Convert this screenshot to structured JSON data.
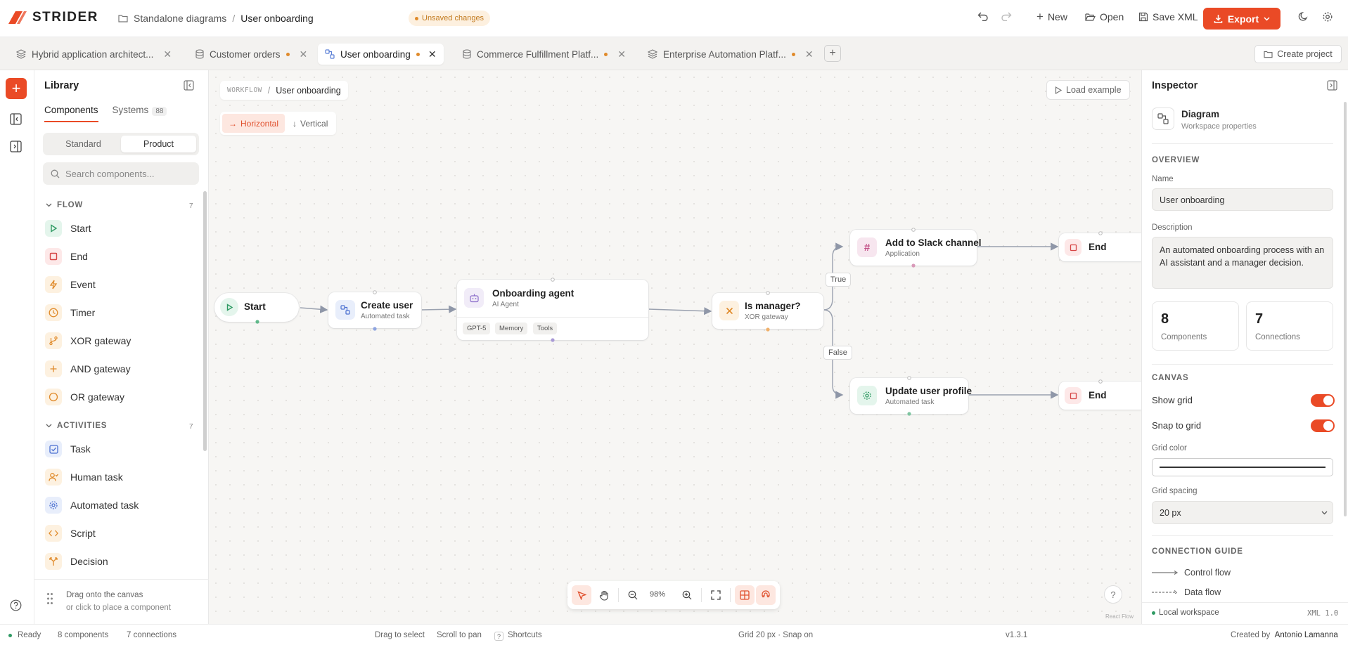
{
  "app": {
    "name": "STRIDER"
  },
  "header": {
    "breadcrumb_root": "Standalone diagrams",
    "breadcrumb_current": "User onboarding",
    "unsaved_label": "Unsaved changes",
    "new_label": "New",
    "open_label": "Open",
    "save_label": "Save XML",
    "export_label": "Export",
    "accent_color": "#ea4a26"
  },
  "tabs": [
    {
      "label": "Hybrid application architect...",
      "icon": "layers-icon",
      "dirty": false,
      "active": false
    },
    {
      "label": "Customer orders",
      "icon": "database-icon",
      "dirty": true,
      "active": false
    },
    {
      "label": "User onboarding",
      "icon": "workflow-icon",
      "dirty": true,
      "active": true
    },
    {
      "label": "Commerce Fulfillment Platf...",
      "icon": "database-icon",
      "dirty": true,
      "active": false
    },
    {
      "label": "Enterprise Automation Platf...",
      "icon": "layers-icon",
      "dirty": true,
      "active": false
    }
  ],
  "create_project_label": "Create project",
  "library": {
    "title": "Library",
    "tab_components": "Components",
    "tab_systems": "Systems",
    "systems_count": "88",
    "seg_standard": "Standard",
    "seg_product": "Product",
    "search_placeholder": "Search components...",
    "sections": [
      {
        "title": "FLOW",
        "count": "7",
        "items": [
          {
            "label": "Start",
            "icon": "play-icon"
          },
          {
            "label": "End",
            "icon": "stop-icon"
          },
          {
            "label": "Event",
            "icon": "bolt-icon"
          },
          {
            "label": "Timer",
            "icon": "clock-icon"
          },
          {
            "label": "XOR gateway",
            "icon": "branch-icon"
          },
          {
            "label": "AND gateway",
            "icon": "plus-icon"
          },
          {
            "label": "OR gateway",
            "icon": "circle-icon"
          }
        ]
      },
      {
        "title": "ACTIVITIES",
        "count": "7",
        "items": [
          {
            "label": "Task",
            "icon": "check-square-icon"
          },
          {
            "label": "Human task",
            "icon": "user-icon"
          },
          {
            "label": "Automated task",
            "icon": "gear-icon"
          },
          {
            "label": "Script",
            "icon": "code-icon"
          },
          {
            "label": "Decision",
            "icon": "split-icon"
          }
        ]
      }
    ],
    "footer_line1": "Drag onto the canvas",
    "footer_line2": "or click to place a component"
  },
  "canvas": {
    "crumb_prefix": "WORKFLOW",
    "crumb_name": "User onboarding",
    "orient_horizontal": "Horizontal",
    "orient_vertical": "Vertical",
    "load_example": "Load example",
    "zoom": "98%",
    "react_flow": "React Flow",
    "nodes": {
      "start": {
        "title": "Start"
      },
      "create_user": {
        "title": "Create user",
        "subtitle": "Automated task"
      },
      "agent": {
        "title": "Onboarding agent",
        "subtitle": "AI Agent",
        "chips": [
          "GPT-5",
          "Memory",
          "Tools"
        ]
      },
      "gateway": {
        "title": "Is manager?",
        "subtitle": "XOR gateway"
      },
      "slack": {
        "title": "Add to Slack channel",
        "subtitle": "Application"
      },
      "update": {
        "title": "Update user profile",
        "subtitle": "Automated task"
      },
      "end1": {
        "title": "End"
      },
      "end2": {
        "title": "End"
      }
    },
    "edge_true": "True",
    "edge_false": "False"
  },
  "inspector": {
    "title": "Inspector",
    "diagram_title": "Diagram",
    "diagram_sub": "Workspace properties",
    "overview": "OVERVIEW",
    "name_label": "Name",
    "name_value": "User onboarding",
    "desc_label": "Description",
    "desc_value": "An automated onboarding process with an AI assistant and a manager decision.",
    "components_count": "8",
    "components_label": "Components",
    "connections_count": "7",
    "connections_label": "Connections",
    "canvas_sec": "CANVAS",
    "show_grid": "Show grid",
    "show_grid_on": true,
    "snap_grid": "Snap to grid",
    "snap_grid_on": true,
    "grid_color_label": "Grid color",
    "grid_spacing_label": "Grid spacing",
    "grid_spacing_value": "20 px",
    "guide_sec": "CONNECTION GUIDE",
    "control_flow": "Control flow",
    "data_flow": "Data flow",
    "workspace": "Local workspace",
    "xml_version": "XML 1.0"
  },
  "status": {
    "ready": "Ready",
    "components": "8 components",
    "connections": "7 connections",
    "drag_select": "Drag to select",
    "scroll_pan": "Scroll to pan",
    "shortcuts_key": "?",
    "shortcuts": "Shortcuts",
    "grid_info": "Grid 20 px · Snap on",
    "version": "v1.3.1",
    "created_by_label": "Created by",
    "author": "Antonio Lamanna"
  }
}
